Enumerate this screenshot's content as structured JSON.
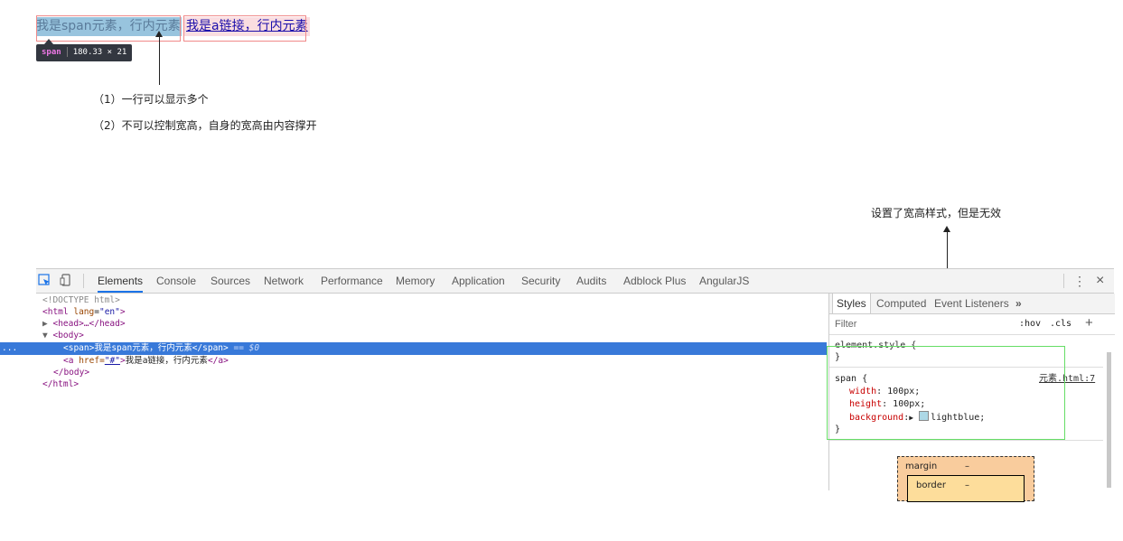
{
  "page": {
    "span_text": "我是span元素，行内元素",
    "link_text": "我是a链接，行内元素",
    "tooltip": {
      "tag": "span",
      "size": "180.33 × 21"
    },
    "notes": [
      "（1）一行可以显示多个",
      "（2）不可以控制宽高，自身的宽高由内容撑开"
    ],
    "annotation": "设置了宽高样式，但是无效"
  },
  "devtools": {
    "tabs": [
      "Elements",
      "Console",
      "Sources",
      "Network",
      "Performance",
      "Memory",
      "Application",
      "Security",
      "Audits",
      "Adblock Plus",
      "AngularJS"
    ],
    "active_tab": "Elements",
    "dom": {
      "doctype": "<!DOCTYPE html>",
      "html_open": "<html",
      "lang_attr": "lang",
      "lang_val": "\"en\"",
      "head": "<head>…</head>",
      "body_open": "<body>",
      "span_line": "<span>我是span元素，行内元素</span>",
      "selected_marker": "== $0",
      "a_open": "<a",
      "href_attr": "href=",
      "href_val": "\"#\"",
      "a_text": "我是a链接，行内元素",
      "a_close": "</a>",
      "body_close": "</body>",
      "html_close": "</html>",
      "ellipsis": "..."
    },
    "styles": {
      "tabs": [
        "Styles",
        "Computed",
        "Event Listeners"
      ],
      "more": "»",
      "filter_placeholder": "Filter",
      "hov": ":hov",
      "cls": ".cls",
      "plus": "+",
      "element_style": "element.style {",
      "close_brace": "}",
      "rule_selector": "span {",
      "rule_source": "元素.html:7",
      "props": [
        {
          "name": "width",
          "value": "100px;"
        },
        {
          "name": "height",
          "value": "100px;"
        },
        {
          "name": "background",
          "value": "lightblue;"
        }
      ]
    },
    "box_model": {
      "margin_label": "margin",
      "margin_value": "–",
      "border_label": "border",
      "border_value": "–"
    },
    "close": "×",
    "menu": "⋮"
  }
}
